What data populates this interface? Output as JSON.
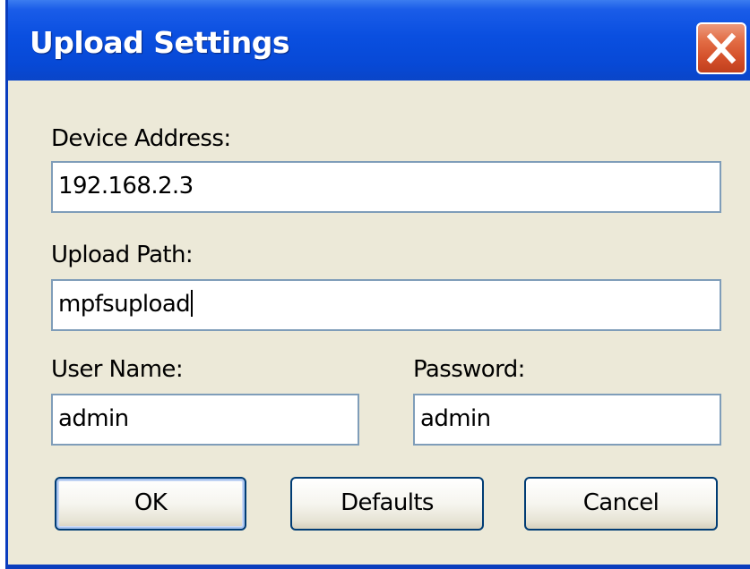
{
  "dialog": {
    "title": "Upload Settings",
    "close_icon": "close-icon"
  },
  "fields": {
    "device_address": {
      "label": "Device Address:",
      "value": "192.168.2.3"
    },
    "upload_path": {
      "label": "Upload Path:",
      "value": "mpfsupload"
    },
    "user_name": {
      "label": "User Name:",
      "value": "admin"
    },
    "password": {
      "label": "Password:",
      "value": "admin"
    }
  },
  "buttons": {
    "ok": "OK",
    "defaults": "Defaults",
    "cancel": "Cancel"
  },
  "colors": {
    "titlebar": "#0a4fe0",
    "client": "#ece9d8",
    "close_button": "#e26c44",
    "field_border": "#7f9db9",
    "button_border": "#003c74"
  }
}
